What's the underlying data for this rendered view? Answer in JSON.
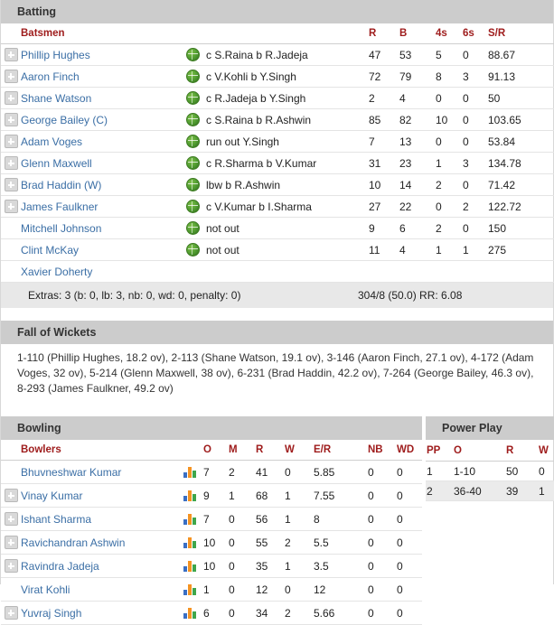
{
  "batting": {
    "section_title": "Batting",
    "columns": {
      "batsmen": "Batsmen",
      "r": "R",
      "b": "B",
      "fours": "4s",
      "sixes": "6s",
      "sr": "S/R"
    },
    "rows": [
      {
        "expand": true,
        "name": "Phillip Hughes",
        "icon": "cricket-ball-icon",
        "dismissal": "c S.Raina b R.Jadeja",
        "r": "47",
        "b": "53",
        "fours": "5",
        "sixes": "0",
        "sr": "88.67"
      },
      {
        "expand": true,
        "name": "Aaron Finch",
        "icon": "cricket-ball-icon",
        "dismissal": "c V.Kohli b Y.Singh",
        "r": "72",
        "b": "79",
        "fours": "8",
        "sixes": "3",
        "sr": "91.13"
      },
      {
        "expand": true,
        "name": "Shane Watson",
        "icon": "cricket-ball-icon",
        "dismissal": "c R.Jadeja b Y.Singh",
        "r": "2",
        "b": "4",
        "fours": "0",
        "sixes": "0",
        "sr": "50"
      },
      {
        "expand": true,
        "name": "George Bailey (C)",
        "icon": "cricket-ball-icon",
        "dismissal": "c S.Raina b R.Ashwin",
        "r": "85",
        "b": "82",
        "fours": "10",
        "sixes": "0",
        "sr": "103.65"
      },
      {
        "expand": true,
        "name": "Adam Voges",
        "icon": "cricket-ball-icon",
        "dismissal": "run out Y.Singh",
        "r": "7",
        "b": "13",
        "fours": "0",
        "sixes": "0",
        "sr": "53.84"
      },
      {
        "expand": true,
        "name": "Glenn Maxwell",
        "icon": "cricket-ball-icon",
        "dismissal": "c R.Sharma b V.Kumar",
        "r": "31",
        "b": "23",
        "fours": "1",
        "sixes": "3",
        "sr": "134.78"
      },
      {
        "expand": true,
        "name": "Brad Haddin (W)",
        "icon": "cricket-ball-icon",
        "dismissal": "lbw b R.Ashwin",
        "r": "10",
        "b": "14",
        "fours": "2",
        "sixes": "0",
        "sr": "71.42"
      },
      {
        "expand": true,
        "name": "James Faulkner",
        "icon": "cricket-ball-icon",
        "dismissal": "c V.Kumar b I.Sharma",
        "r": "27",
        "b": "22",
        "fours": "0",
        "sixes": "2",
        "sr": "122.72"
      },
      {
        "expand": false,
        "name": "Mitchell Johnson",
        "icon": "cricket-ball-icon",
        "dismissal": "not out",
        "r": "9",
        "b": "6",
        "fours": "2",
        "sixes": "0",
        "sr": "150"
      },
      {
        "expand": false,
        "name": "Clint McKay",
        "icon": "cricket-ball-icon",
        "dismissal": "not out",
        "r": "11",
        "b": "4",
        "fours": "1",
        "sixes": "1",
        "sr": "275"
      },
      {
        "expand": false,
        "name": "Xavier Doherty",
        "icon": "",
        "dismissal": "",
        "r": "",
        "b": "",
        "fours": "",
        "sixes": "",
        "sr": ""
      }
    ],
    "extras": "Extras: 3 (b: 0, lb: 3, nb: 0, wd: 0, penalty: 0)",
    "total": "304/8 (50.0) RR: 6.08"
  },
  "fall_of_wickets": {
    "section_title": "Fall of Wickets",
    "text": "1-110 (Phillip Hughes, 18.2 ov), 2-113 (Shane Watson, 19.1 ov), 3-146 (Aaron Finch, 27.1 ov), 4-172 (Adam Voges, 32 ov), 5-214 (Glenn Maxwell, 38 ov), 6-231 (Brad Haddin, 42.2 ov), 7-264 (George Bailey, 46.3 ov), 8-293 (James Faulkner, 49.2 ov)"
  },
  "bowling": {
    "section_title": "Bowling",
    "columns": {
      "bowlers": "Bowlers",
      "o": "O",
      "m": "M",
      "r": "R",
      "w": "W",
      "er": "E/R",
      "nb": "NB",
      "wd": "WD"
    },
    "rows": [
      {
        "expand": false,
        "name": "Bhuvneshwar Kumar",
        "icon": "bar-chart-icon",
        "o": "7",
        "m": "2",
        "r": "41",
        "w": "0",
        "er": "5.85",
        "nb": "0",
        "wd": "0"
      },
      {
        "expand": true,
        "name": "Vinay Kumar",
        "icon": "bar-chart-icon",
        "o": "9",
        "m": "1",
        "r": "68",
        "w": "1",
        "er": "7.55",
        "nb": "0",
        "wd": "0"
      },
      {
        "expand": true,
        "name": "Ishant Sharma",
        "icon": "bar-chart-icon",
        "o": "7",
        "m": "0",
        "r": "56",
        "w": "1",
        "er": "8",
        "nb": "0",
        "wd": "0"
      },
      {
        "expand": true,
        "name": "Ravichandran Ashwin",
        "icon": "bar-chart-icon",
        "o": "10",
        "m": "0",
        "r": "55",
        "w": "2",
        "er": "5.5",
        "nb": "0",
        "wd": "0"
      },
      {
        "expand": true,
        "name": "Ravindra Jadeja",
        "icon": "bar-chart-icon",
        "o": "10",
        "m": "0",
        "r": "35",
        "w": "1",
        "er": "3.5",
        "nb": "0",
        "wd": "0"
      },
      {
        "expand": false,
        "name": "Virat Kohli",
        "icon": "bar-chart-icon",
        "o": "1",
        "m": "0",
        "r": "12",
        "w": "0",
        "er": "12",
        "nb": "0",
        "wd": "0"
      },
      {
        "expand": true,
        "name": "Yuvraj Singh",
        "icon": "bar-chart-icon",
        "o": "6",
        "m": "0",
        "r": "34",
        "w": "2",
        "er": "5.66",
        "nb": "0",
        "wd": "0"
      }
    ]
  },
  "power_play": {
    "section_title": "Power Play",
    "columns": {
      "pp": "PP",
      "o": "O",
      "r": "R",
      "w": "W"
    },
    "rows": [
      {
        "pp": "1",
        "o": "1-10",
        "r": "50",
        "w": "0"
      },
      {
        "pp": "2",
        "o": "36-40",
        "r": "39",
        "w": "1"
      }
    ]
  },
  "colors": {
    "section_bar": "#cccccc",
    "header_text": "#9e1b1b",
    "link": "#3a6ea5",
    "extras_bg": "#e8e8e8"
  }
}
